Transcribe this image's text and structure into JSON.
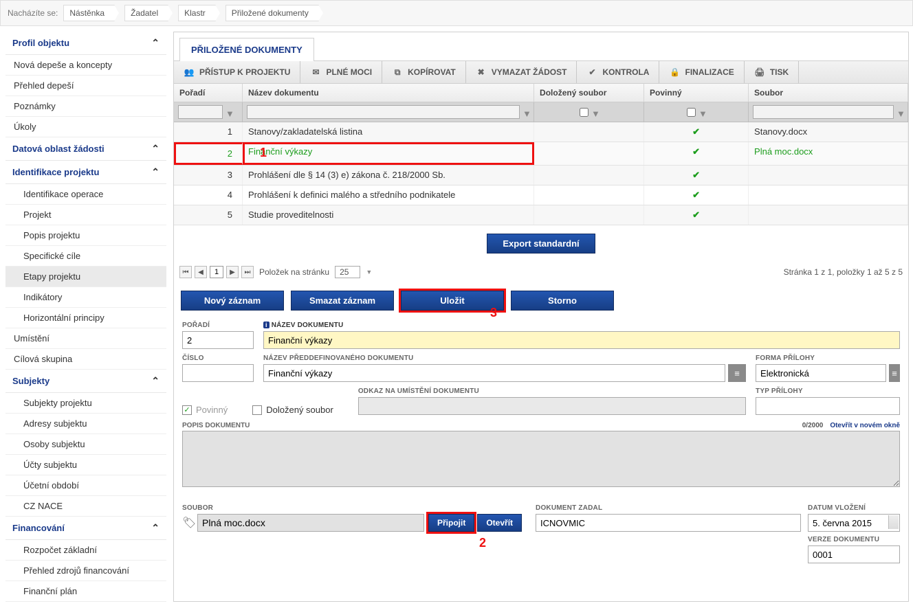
{
  "breadcrumb": {
    "label": "Nacházíte se:",
    "items": [
      "Nástěnka",
      "Žadatel",
      "Klastr",
      "Přiložené dokumenty"
    ]
  },
  "sidebar": [
    {
      "type": "head",
      "label": "Profil objektu",
      "expand": true
    },
    {
      "type": "item",
      "label": "Nová depeše a koncepty"
    },
    {
      "type": "item",
      "label": "Přehled depeší"
    },
    {
      "type": "item",
      "label": "Poznámky"
    },
    {
      "type": "item",
      "label": "Úkoly"
    },
    {
      "type": "head",
      "label": "Datová oblast žádosti",
      "expand": true
    },
    {
      "type": "head",
      "label": "Identifikace projektu",
      "expand": true,
      "blue": true
    },
    {
      "type": "item",
      "label": "Identifikace operace",
      "lvl": 2
    },
    {
      "type": "item",
      "label": "Projekt",
      "lvl": 2
    },
    {
      "type": "item",
      "label": "Popis projektu",
      "lvl": 2
    },
    {
      "type": "item",
      "label": "Specifické cíle",
      "lvl": 2
    },
    {
      "type": "item",
      "label": "Etapy projektu",
      "lvl": 2,
      "sel": true
    },
    {
      "type": "item",
      "label": "Indikátory",
      "lvl": 2
    },
    {
      "type": "item",
      "label": "Horizontální principy",
      "lvl": 2
    },
    {
      "type": "item",
      "label": "Umístění"
    },
    {
      "type": "item",
      "label": "Cílová skupina"
    },
    {
      "type": "head",
      "label": "Subjekty",
      "expand": true,
      "blue": true
    },
    {
      "type": "item",
      "label": "Subjekty projektu",
      "lvl": 2
    },
    {
      "type": "item",
      "label": "Adresy subjektu",
      "lvl": 2
    },
    {
      "type": "item",
      "label": "Osoby subjektu",
      "lvl": 2
    },
    {
      "type": "item",
      "label": "Účty subjektu",
      "lvl": 2
    },
    {
      "type": "item",
      "label": "Účetní období",
      "lvl": 2
    },
    {
      "type": "item",
      "label": "CZ NACE",
      "lvl": 2
    },
    {
      "type": "head",
      "label": "Financování",
      "expand": true,
      "blue": true
    },
    {
      "type": "item",
      "label": "Rozpočet základní",
      "lvl": 2
    },
    {
      "type": "item",
      "label": "Přehled zdrojů financování",
      "lvl": 2
    },
    {
      "type": "item",
      "label": "Finanční plán",
      "lvl": 2
    }
  ],
  "tab": "PŘILOŽENÉ DOKUMENTY",
  "toolbar": [
    {
      "icon": "users",
      "label": "PŘÍSTUP K PROJEKTU"
    },
    {
      "icon": "mail",
      "label": "PLNÉ MOCI"
    },
    {
      "icon": "copy",
      "label": "KOPÍROVAT"
    },
    {
      "icon": "x",
      "label": "VYMAZAT ŽÁDOST"
    },
    {
      "icon": "check",
      "label": "KONTROLA"
    },
    {
      "icon": "lock",
      "label": "FINALIZACE"
    },
    {
      "icon": "print",
      "label": "TISK"
    }
  ],
  "grid": {
    "cols": [
      "Pořadí",
      "Název dokumentu",
      "Doložený soubor",
      "Povinný",
      "Soubor"
    ],
    "rows": [
      {
        "poradi": "1",
        "nazev": "Stanovy/zakladatelská listina",
        "povinny": true,
        "soubor": "Stanovy.docx"
      },
      {
        "poradi": "2",
        "nazev": "Finanční výkazy",
        "povinny": true,
        "soubor": "Plná moc.docx",
        "active": true,
        "annot": "1"
      },
      {
        "poradi": "3",
        "nazev": "Prohlášení dle § 14 (3) e) zákona č. 218/2000 Sb.",
        "povinny": true,
        "soubor": ""
      },
      {
        "poradi": "4",
        "nazev": "Prohlášení k definici malého a středního podnikatele",
        "povinny": true,
        "soubor": ""
      },
      {
        "poradi": "5",
        "nazev": "Studie proveditelnosti",
        "povinny": true,
        "soubor": ""
      }
    ],
    "export": "Export standardní",
    "pager": {
      "page": "1",
      "perpageLabel": "Položek na stránku",
      "perpage": "25",
      "info": "Stránka 1 z 1, položky 1 až 5 z 5"
    }
  },
  "actions": {
    "new": "Nový záznam",
    "del": "Smazat záznam",
    "save": "Uložit",
    "cancel": "Storno",
    "annot": "3"
  },
  "form": {
    "poradi": {
      "label": "POŘADÍ",
      "value": "2"
    },
    "nazevdok": {
      "label": "NÁZEV DOKUMENTU",
      "value": "Finanční výkazy"
    },
    "cislo": {
      "label": "ČÍSLO",
      "value": ""
    },
    "nazevpred": {
      "label": "NÁZEV PŘEDDEFINOVANÉHO DOKUMENTU",
      "value": "Finanční výkazy"
    },
    "forma": {
      "label": "FORMA PŘÍLOHY",
      "value": "Elektronická"
    },
    "typ": {
      "label": "TYP PŘÍLOHY",
      "value": ""
    },
    "povinny": {
      "label": "Povinný",
      "checked": true
    },
    "dolozeny": {
      "label": "Doložený soubor",
      "checked": false
    },
    "odkaz": {
      "label": "ODKAZ NA UMÍSTĚNÍ DOKUMENTU",
      "value": ""
    },
    "popis": {
      "label": "POPIS DOKUMENTU",
      "count": "0/2000",
      "open": "Otevřít v novém okně"
    },
    "soubor": {
      "label": "SOUBOR",
      "value": "Plná moc.docx",
      "attach": "Připojit",
      "open": "Otevřít",
      "annot": "2"
    },
    "zadal": {
      "label": "DOKUMENT ZADAL",
      "value": "ICNOVMIC"
    },
    "datum": {
      "label": "DATUM VLOŽENÍ",
      "value": "5. června 2015"
    },
    "verze": {
      "label": "VERZE DOKUMENTU",
      "value": "0001"
    }
  }
}
